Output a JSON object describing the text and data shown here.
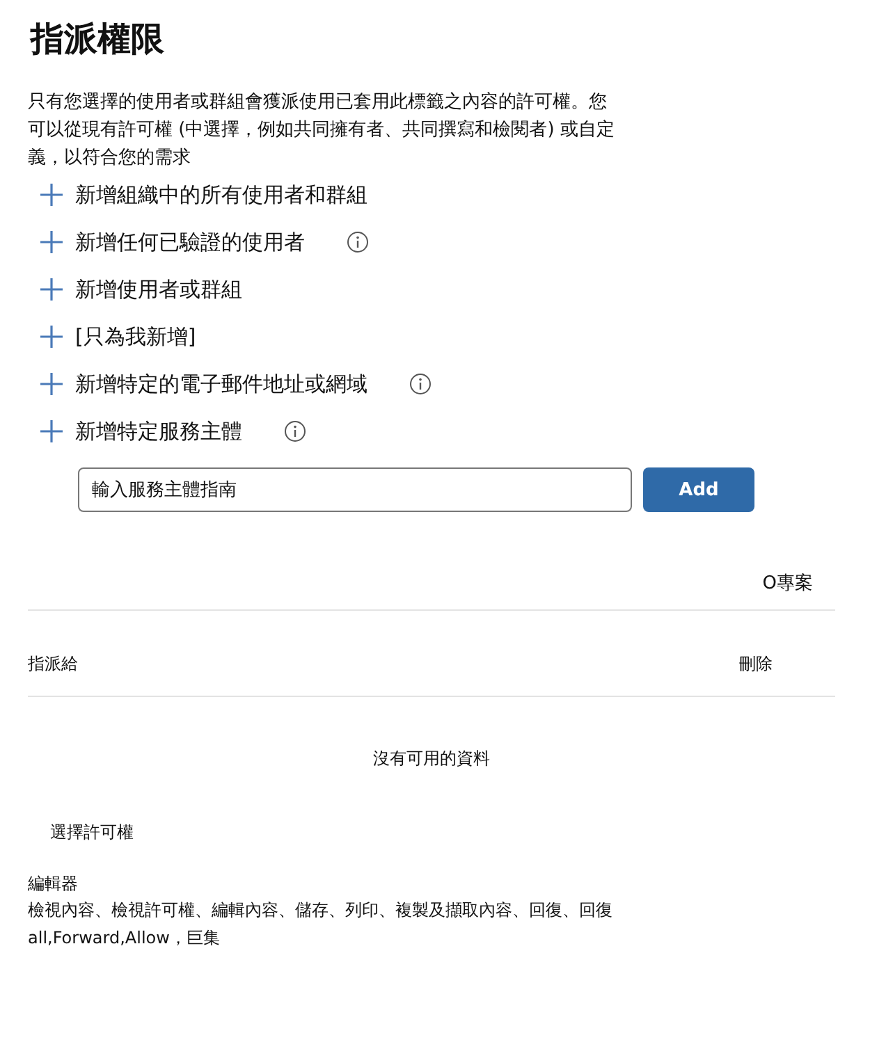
{
  "title": "指派權限",
  "description": "只有您選擇的使用者或群組會獲派使用已套用此標籤之內容的許可權。您可以從現有許可權 (中選擇，例如共同擁有者、共同撰寫和檢閱者) 或自定義，以符合您的需求",
  "add_options": [
    {
      "label": "新增組織中的所有使用者和群組",
      "info": false
    },
    {
      "label": "新增任何已驗證的使用者",
      "info": true
    },
    {
      "label": "新增使用者或群組",
      "info": false
    },
    {
      "label": "[只為我新增]",
      "info": false
    },
    {
      "label": "新增特定的電子郵件地址或網域",
      "info": true
    },
    {
      "label": "新增特定服務主體",
      "info": true
    }
  ],
  "service_principal": {
    "value": "輸入服務主體指南",
    "button": "Add"
  },
  "project_label": "O專案",
  "table": {
    "columns": [
      "指派給",
      "刪除"
    ],
    "empty_message": "沒有可用的資料"
  },
  "choose_permissions": "選擇許可權",
  "role": {
    "name": "編輯器",
    "permissions": "檢視內容、檢視許可權、編輯內容、儲存、列印、複製及擷取內容、回復、回復 all,Forward,Allow，巨集"
  }
}
